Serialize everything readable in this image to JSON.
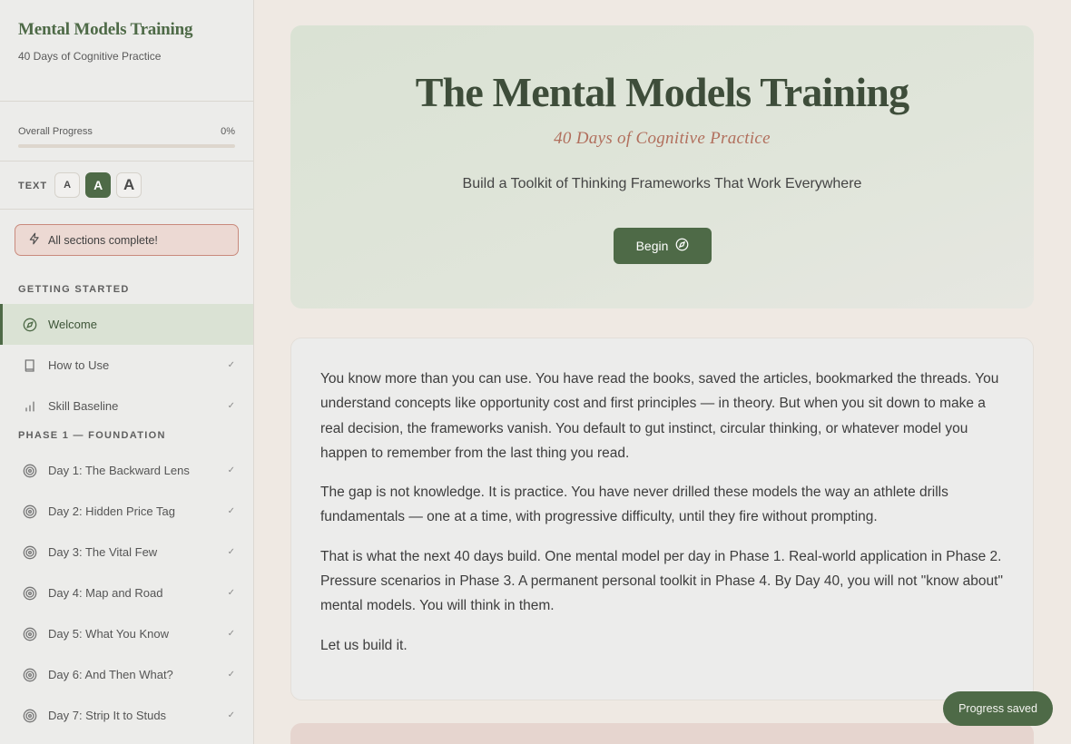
{
  "sidebar": {
    "brand_title": "Mental Models Training",
    "brand_subtitle": "40 Days of Cognitive Practice",
    "progress": {
      "label": "Overall Progress",
      "value_text": "0%",
      "fraction": 0
    },
    "text_size": {
      "label": "TEXT",
      "small": "A",
      "medium": "A",
      "large": "A",
      "selected": "medium"
    },
    "complete_badge": "All sections complete!",
    "sections": [
      {
        "title": "GETTING STARTED",
        "items": [
          {
            "label": "Welcome",
            "icon": "compass-icon",
            "active": true,
            "check": ""
          },
          {
            "label": "How to Use",
            "icon": "book-icon",
            "check": "✓"
          },
          {
            "label": "Skill Baseline",
            "icon": "bar-chart-icon",
            "check": "✓"
          }
        ]
      },
      {
        "title": "PHASE 1 — FOUNDATION",
        "items": [
          {
            "label": "Day 1: The Backward Lens",
            "icon": "target-icon",
            "check": "✓"
          },
          {
            "label": "Day 2: Hidden Price Tag",
            "icon": "target-icon",
            "check": "✓"
          },
          {
            "label": "Day 3: The Vital Few",
            "icon": "target-icon",
            "check": "✓"
          },
          {
            "label": "Day 4: Map and Road",
            "icon": "target-icon",
            "check": "✓"
          },
          {
            "label": "Day 5: What You Know",
            "icon": "target-icon",
            "check": "✓"
          },
          {
            "label": "Day 6: And Then What?",
            "icon": "target-icon",
            "check": "✓"
          },
          {
            "label": "Day 7: Strip It to Studs",
            "icon": "target-icon",
            "check": "✓"
          }
        ]
      }
    ]
  },
  "hero": {
    "title": "The Mental Models Training",
    "subtitle": "40 Days of Cognitive Practice",
    "tagline": "Build a Toolkit of Thinking Frameworks That Work Everywhere",
    "button_label": "Begin"
  },
  "intro": {
    "paragraphs": [
      "You know more than you can use. You have read the books, saved the articles, bookmarked the threads. You understand concepts like opportunity cost and first principles — in theory. But when you sit down to make a real decision, the frameworks vanish. You default to gut instinct, circular thinking, or whatever model you happen to remember from the last thing you read.",
      "The gap is not knowledge. It is practice. You have never drilled these models the way an athlete drills fundamentals — one at a time, with progressive difficulty, until they fire without prompting.",
      "That is what the next 40 days build. One mental model per day in Phase 1. Real-world application in Phase 2. Pressure scenarios in Phase 3. A permanent personal toolkit in Phase 4. By Day 40, you will not \"know about\" mental models. You will think in them.",
      "Let us build it."
    ]
  },
  "toast": "Progress saved",
  "colors": {
    "accent": "#4e6a47",
    "hero_subtitle": "#b16f5d",
    "badge_border": "#c98a7d",
    "background": "#efe9e3"
  }
}
